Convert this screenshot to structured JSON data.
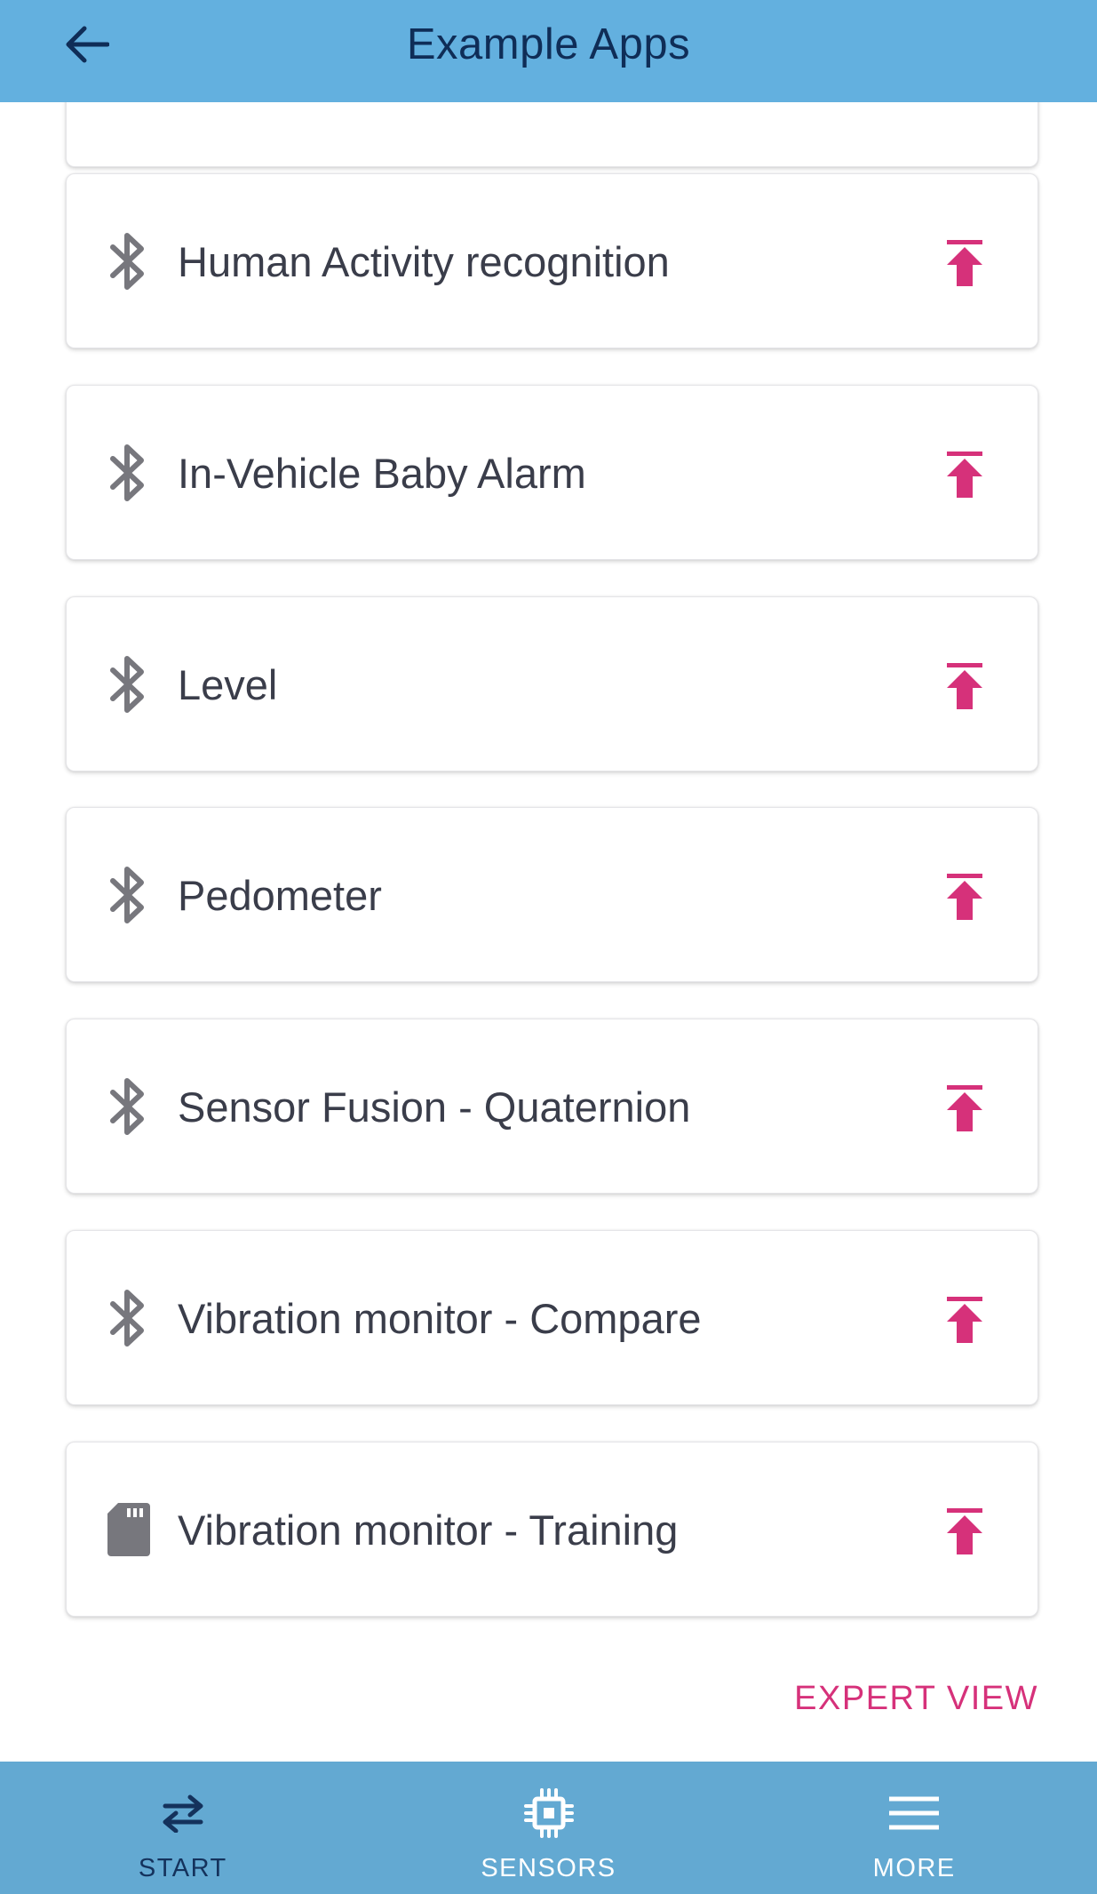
{
  "header": {
    "title": "Example Apps",
    "back_icon": "arrow-left-icon",
    "background": "#63b0df",
    "title_color": "#0f2d57"
  },
  "apps": [
    {
      "label": "Human Activity recognition",
      "type": "bluetooth"
    },
    {
      "label": "In-Vehicle Baby Alarm",
      "type": "bluetooth"
    },
    {
      "label": "Level",
      "type": "bluetooth"
    },
    {
      "label": "Pedometer",
      "type": "bluetooth"
    },
    {
      "label": "Sensor Fusion - Quaternion",
      "type": "bluetooth"
    },
    {
      "label": "Vibration monitor - Compare",
      "type": "bluetooth"
    },
    {
      "label": "Vibration monitor - Training",
      "type": "sd-card"
    }
  ],
  "actions": {
    "expert_view": "EXPERT VIEW",
    "upload_icon": "upload-icon",
    "accent_color": "#d6317a"
  },
  "bottom_nav": {
    "items": [
      {
        "label": "START",
        "icon": "swap-arrows-icon",
        "active": true
      },
      {
        "label": "SENSORS",
        "icon": "chip-icon",
        "active": false
      },
      {
        "label": "MORE",
        "icon": "menu-icon",
        "active": false
      }
    ],
    "background": "#63a9d2"
  }
}
